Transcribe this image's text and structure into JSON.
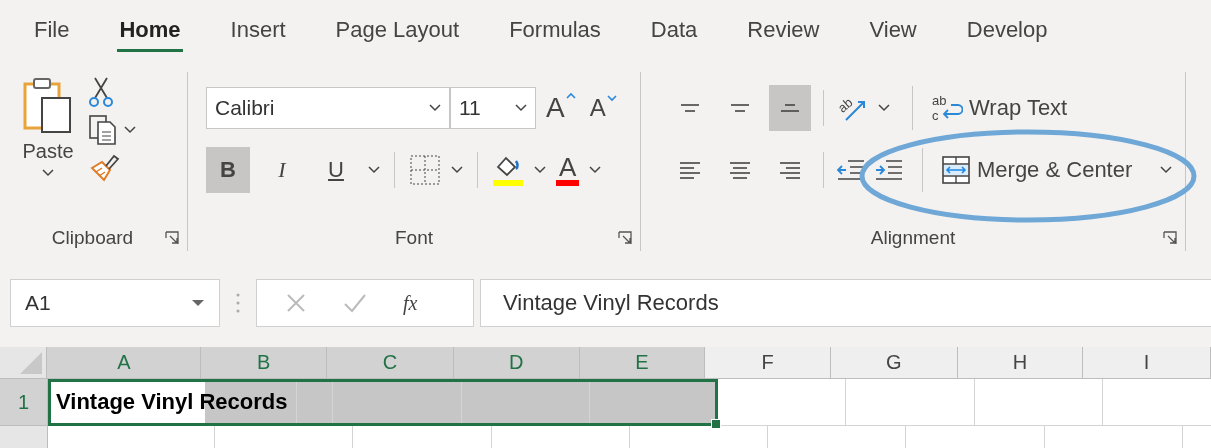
{
  "tabs": [
    {
      "label": "File",
      "selected": false
    },
    {
      "label": "Home",
      "selected": true
    },
    {
      "label": "Insert",
      "selected": false
    },
    {
      "label": "Page Layout",
      "selected": false
    },
    {
      "label": "Formulas",
      "selected": false
    },
    {
      "label": "Data",
      "selected": false
    },
    {
      "label": "Review",
      "selected": false
    },
    {
      "label": "View",
      "selected": false
    },
    {
      "label": "Develop",
      "selected": false
    }
  ],
  "ribbon": {
    "clipboard": {
      "label": "Clipboard",
      "paste": "Paste"
    },
    "font": {
      "label": "Font",
      "font_name": "Calibri",
      "font_size": "11",
      "grow_label": "A",
      "shrink_label": "A",
      "styles": [
        {
          "label": "B",
          "kind": "bold",
          "selected": true
        },
        {
          "label": "I",
          "kind": "italic",
          "selected": false
        },
        {
          "label": "U",
          "kind": "underline",
          "selected": false
        }
      ],
      "font_color_label": "A"
    },
    "alignment": {
      "label": "Alignment",
      "vertical": [
        {
          "kind": "top",
          "selected": false
        },
        {
          "kind": "middle",
          "selected": false
        },
        {
          "kind": "bottom",
          "selected": true
        }
      ],
      "horizontal": [
        {
          "kind": "left",
          "selected": false
        },
        {
          "kind": "center",
          "selected": false
        },
        {
          "kind": "right",
          "selected": false
        }
      ],
      "orientation_icon_text": "ab",
      "wrap_icon_text": [
        "ab",
        "c"
      ],
      "wrap_text": "Wrap Text",
      "merge_center": "Merge & Center"
    }
  },
  "formula_bar": {
    "name_box": "A1",
    "function_label": "fx",
    "value": "Vintage Vinyl Records"
  },
  "sheet": {
    "columns": [
      {
        "label": "A",
        "selected": true
      },
      {
        "label": "B",
        "selected": true
      },
      {
        "label": "C",
        "selected": true
      },
      {
        "label": "D",
        "selected": true
      },
      {
        "label": "E",
        "selected": true
      },
      {
        "label": "F",
        "selected": false
      },
      {
        "label": "G",
        "selected": false
      },
      {
        "label": "H",
        "selected": false
      },
      {
        "label": "I",
        "selected": false
      }
    ],
    "rows": [
      {
        "label": "1",
        "cells": [
          {
            "text": "Vintage Vinyl Records",
            "selected": true
          },
          {
            "selected": true
          },
          {
            "selected": true
          },
          {
            "selected": true
          },
          {
            "selected": true
          },
          {
            "selected": false
          },
          {
            "selected": false
          },
          {
            "selected": false
          },
          {
            "selected": false
          }
        ]
      }
    ]
  }
}
